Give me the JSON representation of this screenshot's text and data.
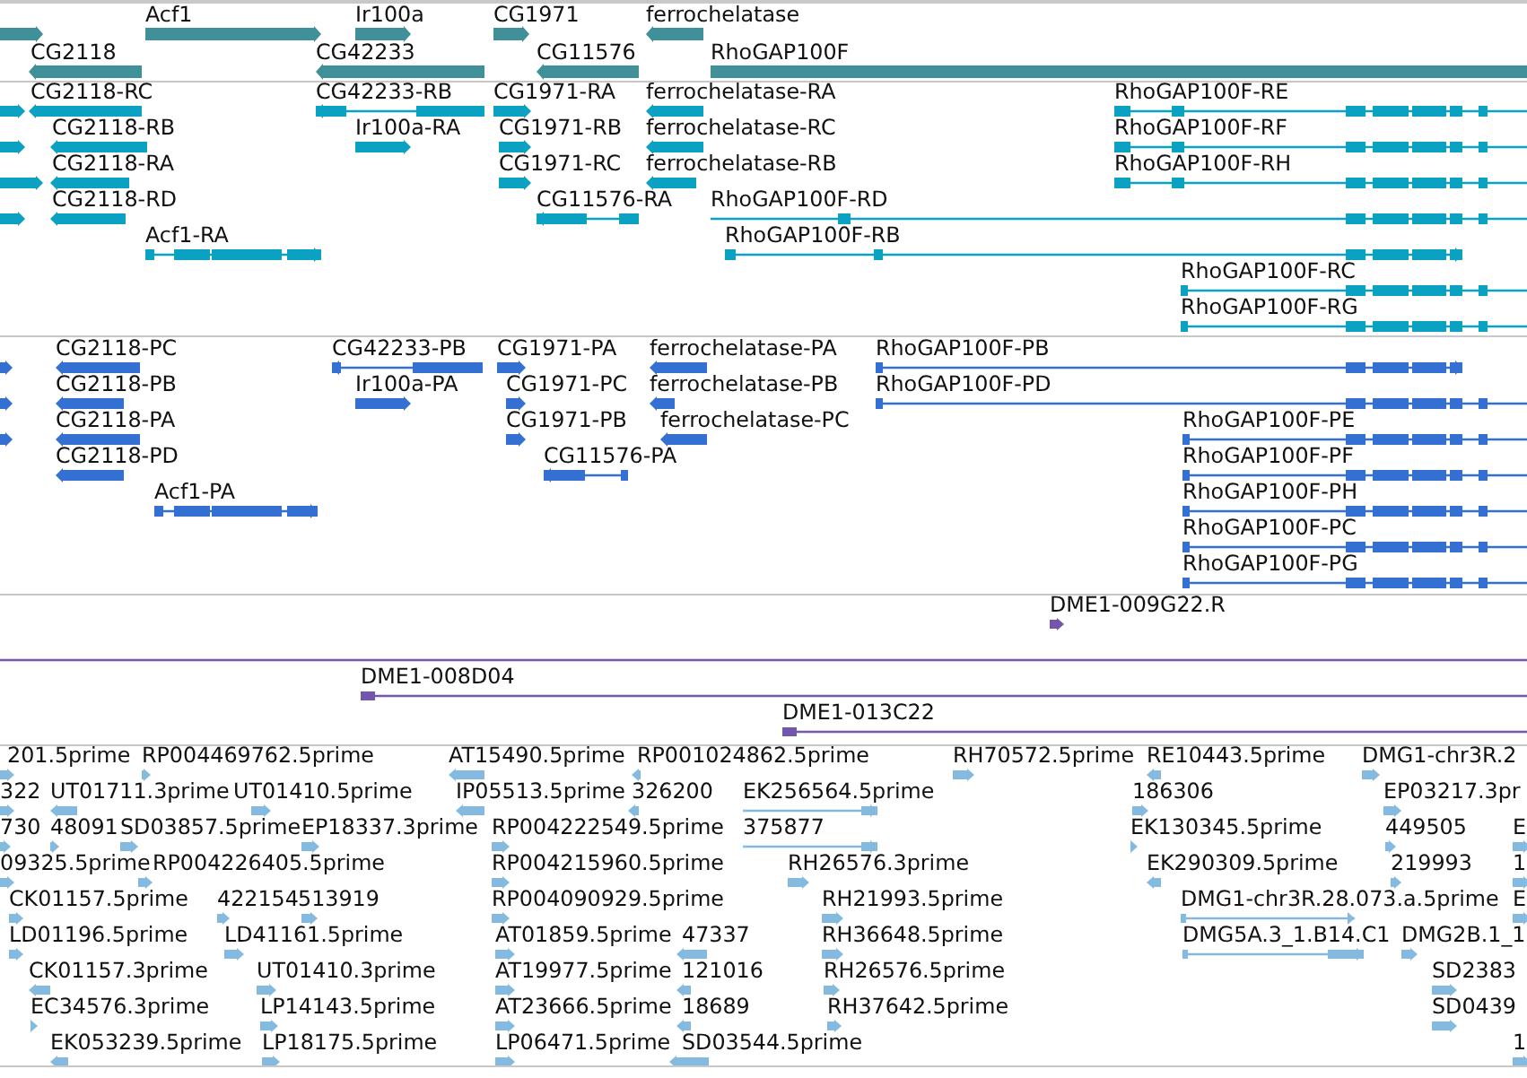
{
  "tracks": [
    {
      "kind": "gene",
      "features": [
        {
          "kind": "stub"
        },
        {
          "label": "Acf1"
        },
        {
          "label": "Ir100a"
        },
        {
          "label": "CG1971"
        },
        {
          "label": "ferrochelatase"
        },
        {
          "label": "CG2118"
        },
        {
          "label": "CG42233"
        },
        {
          "label": "CG11576"
        },
        {
          "label": "RhoGAP100F"
        }
      ]
    },
    {
      "kind": "transcript",
      "features": [
        {
          "kind": "stub"
        },
        {
          "kind": "stub"
        },
        {
          "kind": "stub"
        },
        {
          "kind": "stub"
        },
        {
          "label": "CG2118-RC"
        },
        {
          "label": "CG2118-RB"
        },
        {
          "label": "CG2118-RA"
        },
        {
          "label": "CG2118-RD"
        },
        {
          "label": "Acf1-RA"
        },
        {
          "label": "CG42233-RB"
        },
        {
          "label": "Ir100a-RA"
        },
        {
          "label": "CG1971-RA"
        },
        {
          "label": "CG1971-RB"
        },
        {
          "label": "CG1971-RC"
        },
        {
          "label": "CG11576-RA"
        },
        {
          "label": "ferrochelatase-RA"
        },
        {
          "label": "ferrochelatase-RC"
        },
        {
          "label": "ferrochelatase-RB"
        },
        {
          "label": "RhoGAP100F-RD"
        },
        {
          "label": "RhoGAP100F-RB"
        },
        {
          "label": "RhoGAP100F-RE"
        },
        {
          "label": "RhoGAP100F-RF"
        },
        {
          "label": "RhoGAP100F-RH"
        },
        {
          "label": "RhoGAP100F-RC"
        },
        {
          "label": "RhoGAP100F-RG"
        }
      ]
    },
    {
      "kind": "protein",
      "features": [
        {
          "kind": "stub"
        },
        {
          "kind": "stub"
        },
        {
          "kind": "stub"
        },
        {
          "label": "CG2118-PC"
        },
        {
          "label": "CG2118-PB"
        },
        {
          "label": "CG2118-PA"
        },
        {
          "label": "CG2118-PD"
        },
        {
          "label": "Acf1-PA"
        },
        {
          "label": "CG42233-PB"
        },
        {
          "label": "Ir100a-PA"
        },
        {
          "label": "CG1971-PA"
        },
        {
          "label": "CG1971-PC"
        },
        {
          "label": "CG1971-PB"
        },
        {
          "label": "CG11576-PA"
        },
        {
          "label": "ferrochelatase-PA"
        },
        {
          "label": "ferrochelatase-PB"
        },
        {
          "label": "ferrochelatase-PC"
        },
        {
          "label": "RhoGAP100F-PB"
        },
        {
          "label": "RhoGAP100F-PD"
        },
        {
          "label": "RhoGAP100F-PE"
        },
        {
          "label": "RhoGAP100F-PF"
        },
        {
          "label": "RhoGAP100F-PH"
        },
        {
          "label": "RhoGAP100F-PC"
        },
        {
          "label": "RhoGAP100F-PG"
        }
      ]
    },
    {
      "kind": "clone",
      "features": [
        {
          "label": "DME1-009G22.R"
        },
        {
          "kind": "stub"
        },
        {
          "label": "DME1-008D04"
        },
        {
          "label": "DME1-013C22"
        }
      ]
    },
    {
      "kind": "est",
      "features": [
        {
          "label": "201.5prime"
        },
        {
          "label": "RP004469762.5prime"
        },
        {
          "label": "AT15490.5prime"
        },
        {
          "label": "RP001024862.5prime"
        },
        {
          "label": "RH70572.5prime"
        },
        {
          "label": "RE10443.5prime"
        },
        {
          "label": "DMG1-chr3R.2"
        },
        {
          "label": "322"
        },
        {
          "label": "UT01711.3prime"
        },
        {
          "label": "UT01410.5prime"
        },
        {
          "label": "IP05513.5prime"
        },
        {
          "label": "326200"
        },
        {
          "label": "EK256564.5prime"
        },
        {
          "label": "186306"
        },
        {
          "label": "EP03217.3pr"
        },
        {
          "label": "730"
        },
        {
          "label": "48091"
        },
        {
          "label": "SD03857.5prime"
        },
        {
          "label": "EP18337.3prime"
        },
        {
          "label": "RP004222549.5prime"
        },
        {
          "label": "375877"
        },
        {
          "label": "EK130345.5prime"
        },
        {
          "label": "449505"
        },
        {
          "label": "E"
        },
        {
          "label": "09325.5prime"
        },
        {
          "label": "RP004226405.5prime"
        },
        {
          "label": "RP004215960.5prime"
        },
        {
          "label": "RH26576.3prime"
        },
        {
          "label": "EK290309.5prime"
        },
        {
          "label": "219993"
        },
        {
          "label": "1"
        },
        {
          "label": "CK01157.5prime"
        },
        {
          "label": "422154"
        },
        {
          "label": "513919"
        },
        {
          "label": "RP004090929.5prime"
        },
        {
          "label": "RH21993.5prime"
        },
        {
          "label": "DMG1-chr3R.28.073.a.5prime"
        },
        {
          "label": "E"
        },
        {
          "label": "LD01196.5prime"
        },
        {
          "label": "LD41161.5prime"
        },
        {
          "label": "AT01859.5prime"
        },
        {
          "label": "47337"
        },
        {
          "label": "RH36648.5prime"
        },
        {
          "label": "DMG5A.3_1.B14.C1"
        },
        {
          "label": "DMG2B.1_1"
        },
        {
          "label": "CK01157.3prime"
        },
        {
          "label": "UT01410.3prime"
        },
        {
          "label": "AT19977.5prime"
        },
        {
          "label": "121016"
        },
        {
          "label": "RH26576.5prime"
        },
        {
          "label": "SD2383"
        },
        {
          "label": "EC34576.3prime"
        },
        {
          "label": "LP14143.5prime"
        },
        {
          "label": "AT23666.5prime"
        },
        {
          "label": "18689"
        },
        {
          "label": "RH37642.5prime"
        },
        {
          "label": "SD0439"
        },
        {
          "label": "EK053239.5prime"
        },
        {
          "label": "LP18175.5prime"
        },
        {
          "label": "LP06471.5prime"
        },
        {
          "label": "SD03544.5prime"
        },
        {
          "label": "1"
        }
      ]
    }
  ]
}
